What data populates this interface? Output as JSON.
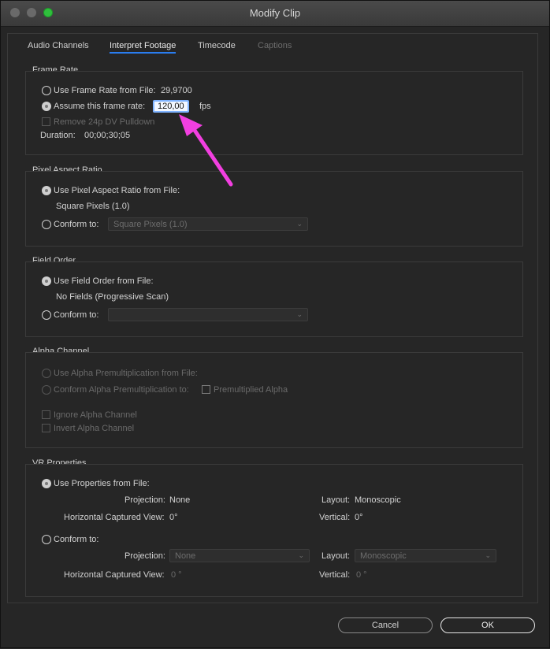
{
  "window": {
    "title": "Modify Clip"
  },
  "tabs": [
    {
      "label": "Audio Channels"
    },
    {
      "label": "Interpret Footage"
    },
    {
      "label": "Timecode"
    },
    {
      "label": "Captions"
    }
  ],
  "frame_rate": {
    "title": "Frame Rate",
    "use_from_file_label": "Use Frame Rate from File:",
    "file_value": "29,9700",
    "assume_label": "Assume this frame rate:",
    "assume_value": "120,00",
    "fps_label": "fps",
    "pulldown_label": "Remove 24p DV Pulldown",
    "duration_label": "Duration:",
    "duration_value": "00;00;30;05"
  },
  "pixel_aspect": {
    "title": "Pixel Aspect Ratio",
    "use_from_file_label": "Use Pixel Aspect Ratio from File:",
    "file_value": "Square Pixels (1.0)",
    "conform_label": "Conform to:",
    "conform_value": "Square Pixels (1.0)"
  },
  "field_order": {
    "title": "Field Order",
    "use_from_file_label": "Use Field Order from File:",
    "file_value": "No Fields (Progressive Scan)",
    "conform_label": "Conform to:",
    "conform_value": ""
  },
  "alpha": {
    "title": "Alpha Channel",
    "use_premult_label": "Use Alpha Premultiplication from File:",
    "conform_premult_label": "Conform Alpha Premultiplication to:",
    "premultiplied_label": "Premultiplied Alpha",
    "ignore_label": "Ignore Alpha Channel",
    "invert_label": "Invert Alpha Channel"
  },
  "vr": {
    "title": "VR Properties",
    "use_from_file_label": "Use Properties from File:",
    "projection_label": "Projection:",
    "projection_value": "None",
    "layout_label": "Layout:",
    "layout_value": "Monoscopic",
    "hcv_label": "Horizontal Captured View:",
    "hcv_value": "0°",
    "vertical_label": "Vertical:",
    "vertical_value": "0°",
    "conform_label": "Conform to:",
    "conform_projection_value": "None",
    "conform_layout_value": "Monoscopic",
    "conform_hcv_value": "0 °",
    "conform_vertical_value": "0 °"
  },
  "buttons": {
    "cancel": "Cancel",
    "ok": "OK"
  },
  "annotation": {
    "arrow_color": "#f23fe0"
  },
  "colors": {
    "accent_tab_underline": "#2a7df0",
    "input_focus": "#7fb3ff"
  }
}
